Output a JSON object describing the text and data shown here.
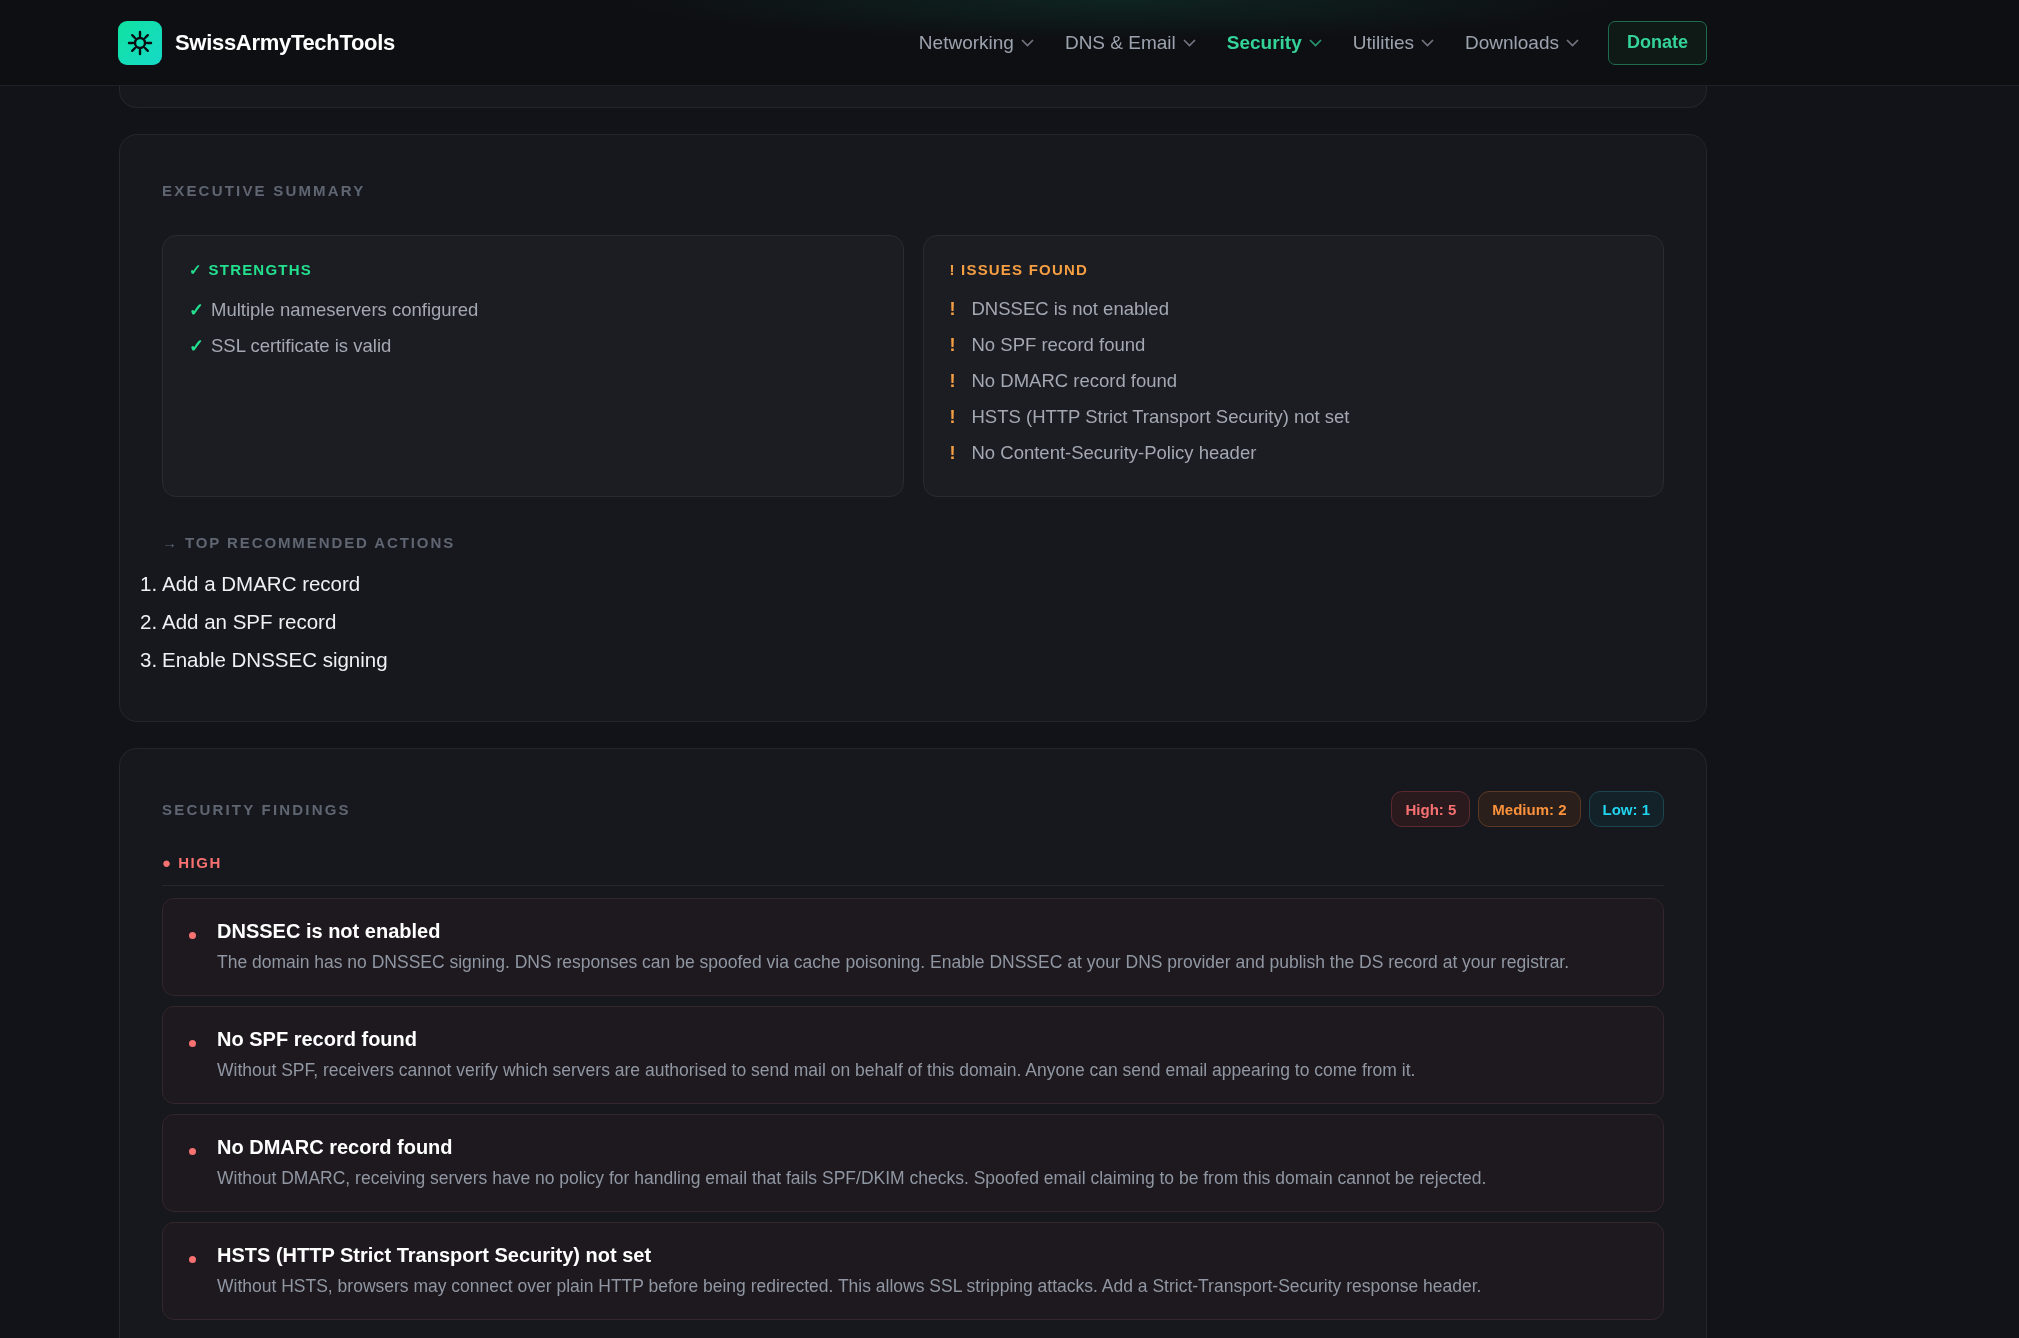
{
  "header": {
    "brand": "SwissArmyTechTools",
    "nav": [
      {
        "label": "Networking",
        "selected": false
      },
      {
        "label": "DNS & Email",
        "selected": false
      },
      {
        "label": "Security",
        "selected": true
      },
      {
        "label": "Utilities",
        "selected": false
      },
      {
        "label": "Downloads",
        "selected": false
      }
    ],
    "donate": "Donate"
  },
  "executive_summary": {
    "title": "EXECUTIVE SUMMARY",
    "panels": [
      {
        "kind": "strengths",
        "title": "✓ STRENGTHS",
        "items": [
          {
            "icon": "✓",
            "text": "Multiple nameservers configured"
          },
          {
            "icon": "✓",
            "text": "SSL certificate is valid"
          }
        ]
      },
      {
        "kind": "issues",
        "title": "! ISSUES FOUND",
        "items": [
          {
            "icon": "!",
            "text": "DNSSEC is not enabled"
          },
          {
            "icon": "!",
            "text": "No SPF record found"
          },
          {
            "icon": "!",
            "text": "No DMARC record found"
          },
          {
            "icon": "!",
            "text": "HSTS (HTTP Strict Transport Security) not set"
          },
          {
            "icon": "!",
            "text": "No Content-Security-Policy header"
          }
        ]
      }
    ],
    "actions": {
      "title": "→ TOP RECOMMENDED ACTIONS",
      "items": [
        {
          "number": "1.",
          "text": "Add a DMARC record"
        },
        {
          "number": "2.",
          "text": "Add an SPF record"
        },
        {
          "number": "3.",
          "text": "Enable DNSSEC signing"
        }
      ]
    }
  },
  "security_findings": {
    "title": "SECURITY FINDINGS",
    "badges": [
      {
        "kind": "high",
        "label": "High: 5"
      },
      {
        "kind": "medium",
        "label": "Medium: 2"
      },
      {
        "kind": "low",
        "label": "Low: 1"
      }
    ],
    "groups": [
      {
        "kind": "high",
        "label": "● HIGH",
        "findings": [
          {
            "title": "DNSSEC is not enabled",
            "description": "The domain has no DNSSEC signing. DNS responses can be spoofed via cache poisoning. Enable DNSSEC at your DNS provider and publish the DS record at your registrar."
          },
          {
            "title": "No SPF record found",
            "description": "Without SPF, receivers cannot verify which servers are authorised to send mail on behalf of this domain. Anyone can send email appearing to come from it."
          },
          {
            "title": "No DMARC record found",
            "description": "Without DMARC, receiving servers have no policy for handling email that fails SPF/DKIM checks. Spoofed email claiming to be from this domain cannot be rejected."
          },
          {
            "title": "HSTS (HTTP Strict Transport Security) not set",
            "description": "Without HSTS, browsers may connect over plain HTTP before being redirected. This allows SSL stripping attacks. Add a Strict-Transport-Security response header."
          }
        ]
      }
    ]
  }
}
